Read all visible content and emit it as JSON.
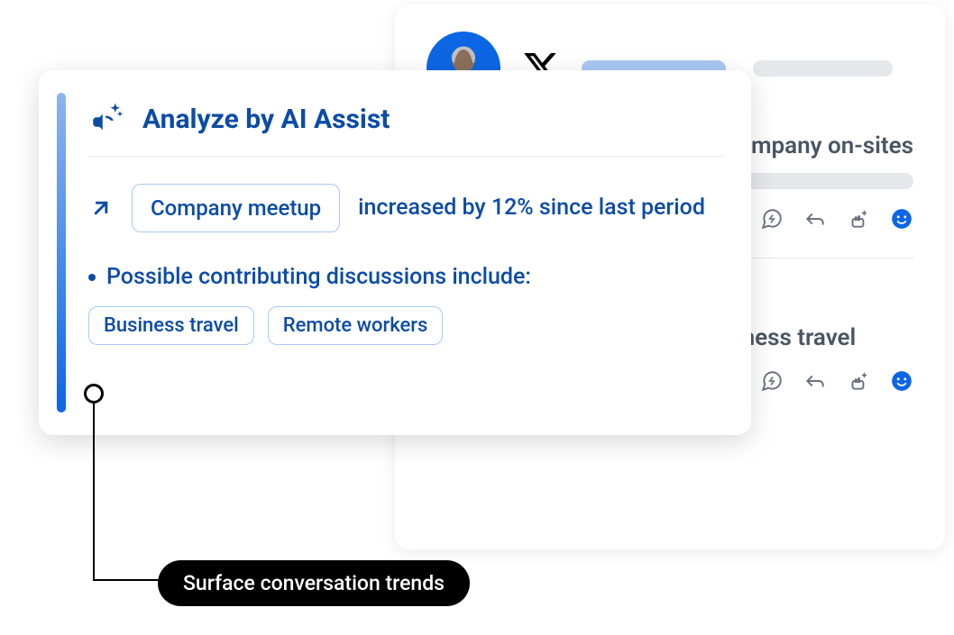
{
  "ai_assist": {
    "title": "Analyze by AI Assist",
    "topic": "Company meetup",
    "trend_text": "increased by 12% since last period",
    "contributing_label": "Possible contributing discussions include:",
    "contributing_topics": [
      "Business travel",
      "Remote workers"
    ]
  },
  "social_posts": {
    "post1_text": "mpany on-sites",
    "post2_text": "booking business travel"
  },
  "callout": {
    "label": "Surface conversation trends"
  }
}
